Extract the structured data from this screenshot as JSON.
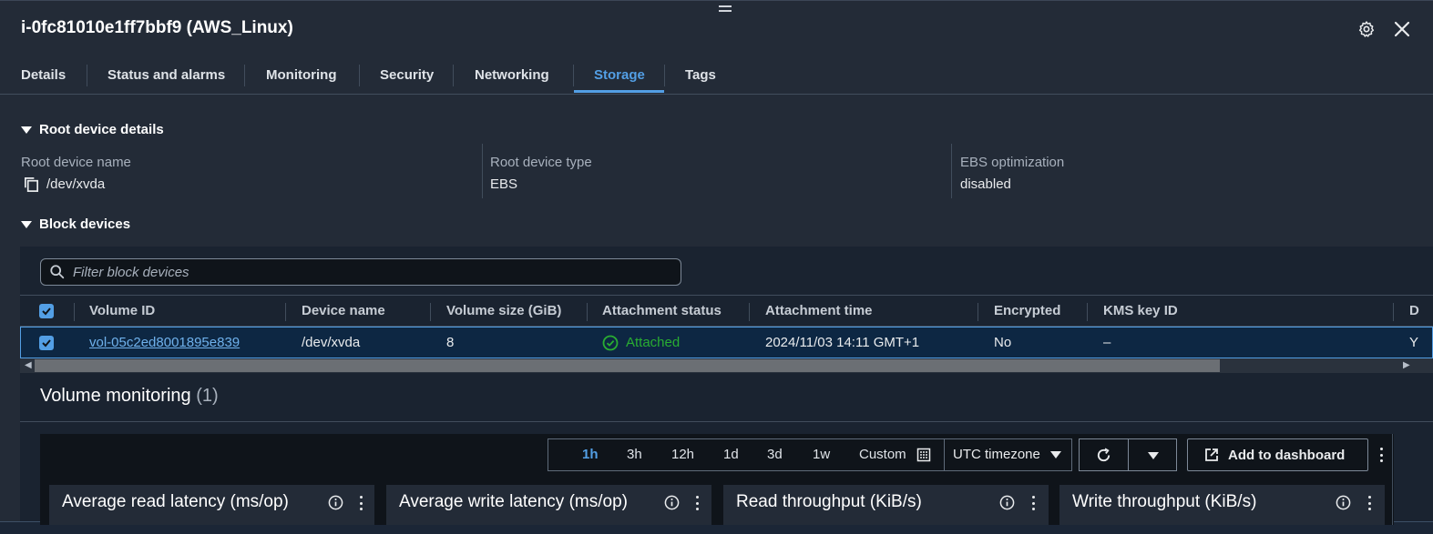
{
  "header": {
    "title": "i-0fc81010e1ff7bbf9 (AWS_Linux)"
  },
  "tabs": [
    "Details",
    "Status and alarms",
    "Monitoring",
    "Security",
    "Networking",
    "Storage",
    "Tags"
  ],
  "active_tab": "Storage",
  "root_device": {
    "heading": "Root device details",
    "fields": [
      {
        "label": "Root device name",
        "value": "/dev/xvda"
      },
      {
        "label": "Root device type",
        "value": "EBS"
      },
      {
        "label": "EBS optimization",
        "value": "disabled"
      }
    ]
  },
  "block_devices": {
    "heading": "Block devices",
    "filter_placeholder": "Filter block devices",
    "columns": [
      "Volume ID",
      "Device name",
      "Volume size (GiB)",
      "Attachment status",
      "Attachment time",
      "Encrypted",
      "KMS key ID",
      "D"
    ],
    "rows": [
      {
        "volume_id": "vol-05c2ed8001895e839",
        "device_name": "/dev/xvda",
        "size": "8",
        "status": "Attached",
        "time": "2024/11/03 14:11 GMT+1",
        "encrypted": "No",
        "kms": "–",
        "extra": "Y"
      }
    ]
  },
  "volume_monitoring": {
    "title": "Volume monitoring",
    "count": "(1)",
    "ranges": [
      "1h",
      "3h",
      "12h",
      "1d",
      "3d",
      "1w",
      "Custom"
    ],
    "active_range": "1h",
    "timezone": "UTC timezone",
    "add_dashboard": "Add to dashboard",
    "widgets": [
      "Average read latency (ms/op)",
      "Average write latency (ms/op)",
      "Read throughput (KiB/s)",
      "Write throughput (KiB/s)"
    ]
  },
  "colors": {
    "accent": "#539fe5",
    "success": "#29ad32",
    "link": "#6fb1ec"
  }
}
